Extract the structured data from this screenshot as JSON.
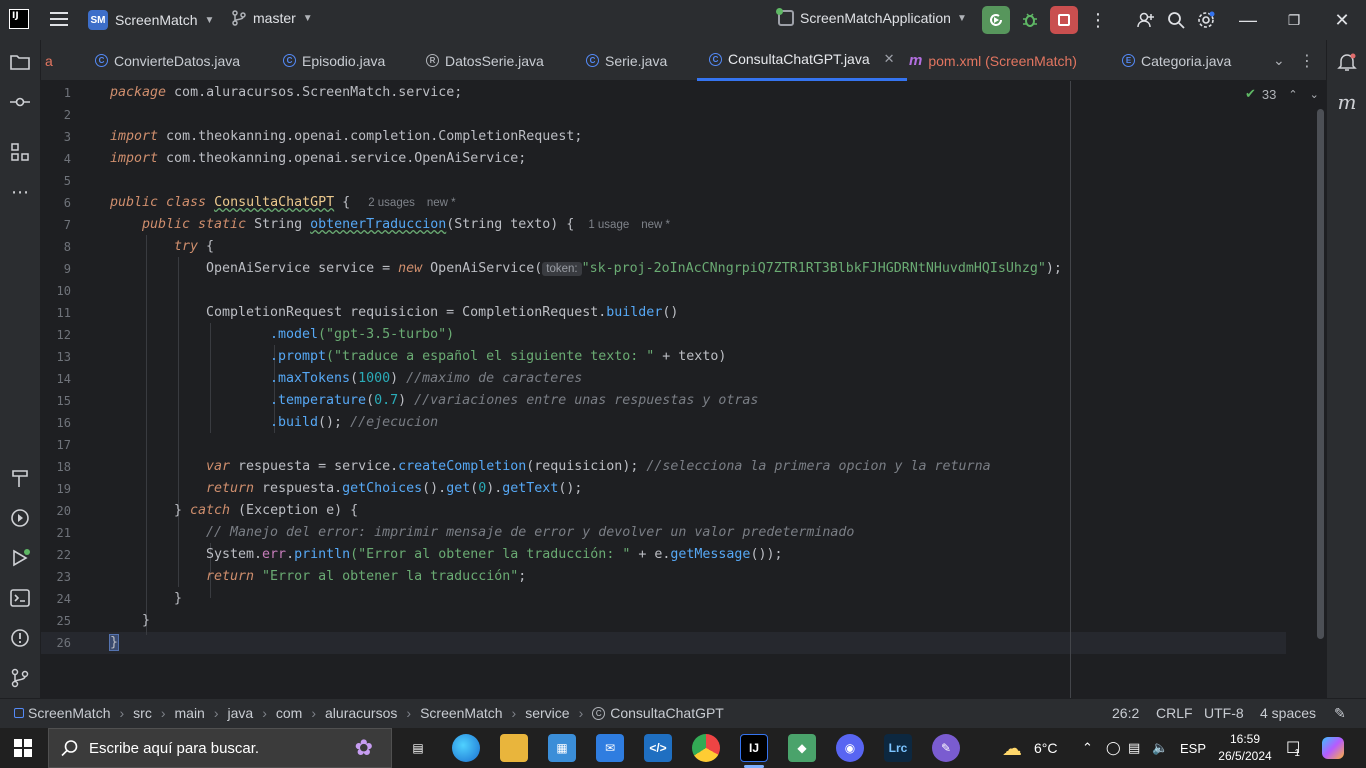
{
  "titlebar": {
    "project": "ScreenMatch",
    "project_badge": "SM",
    "logo": "IJ",
    "branch": "master",
    "run_config": "ScreenMatchApplication"
  },
  "tabs": [
    {
      "label": "a"
    },
    {
      "label": "ConvierteDatos.java"
    },
    {
      "label": "Episodio.java"
    },
    {
      "label": "DatosSerie.java"
    },
    {
      "label": "Serie.java"
    },
    {
      "label": "ConsultaChatGPT.java",
      "active": true
    },
    {
      "label": "pom.xml (ScreenMatch)"
    },
    {
      "label": "Categoria.java"
    }
  ],
  "editor": {
    "line_numbers": [
      "1",
      "2",
      "3",
      "4",
      "5",
      "6",
      "7",
      "8",
      "9",
      "10",
      "11",
      "12",
      "13",
      "14",
      "15",
      "16",
      "17",
      "18",
      "19",
      "20",
      "21",
      "22",
      "23",
      "24",
      "25",
      "26"
    ],
    "inspection_count": "33",
    "hints": {
      "class_usages": "2 usages",
      "class_new": "new *",
      "method_usages": "1 usage",
      "method_new": "new *",
      "token_label": "token:"
    },
    "code": {
      "l1_kw": "package",
      "l1_rest": " com.aluracursos.ScreenMatch.service;",
      "l3_kw": "import",
      "l3_rest": " com.theokanning.openai.completion.CompletionRequest;",
      "l4_kw": "import",
      "l4_rest": " com.theokanning.openai.service.OpenAiService;",
      "l6_kw": "public class ",
      "l6_name": "ConsultaChatGPT",
      "l6_brace": " {",
      "l7_kw": "public static ",
      "l7_type": "String ",
      "l7_fn": "obtenerTraduccion",
      "l7_rest": "(String texto) {",
      "l8_kw": "try",
      "l8_rest": " {",
      "l9_a": "OpenAiService service = ",
      "l9_new": "new",
      "l9_b": " OpenAiService(",
      "l9_str": "\"sk-proj-2oInAcCNngrpiQ7ZTR1RT3BlbkFJHGDRNtNHuvdmHQIsUhzg\"",
      "l9_end": ");",
      "l11_a": "CompletionRequest requisicion = CompletionRequest.",
      "l11_fn": "builder",
      "l11_end": "()",
      "l12_fn": ".model",
      "l12_str": "(\"gpt-3.5-turbo\")",
      "l13_fn": ".prompt",
      "l13_str": "(\"traduce a español el siguiente texto: \"",
      "l13_end": " + texto)",
      "l14_fn": ".maxTokens",
      "l14_num": "1000",
      "l14_cmt": "//maximo de caracteres",
      "l15_fn": ".temperature",
      "l15_num": "0.7",
      "l15_cmt": "//variaciones entre unas respuestas y otras",
      "l16_fn": ".build",
      "l16_cmt": "//ejecucion",
      "l18_kw": "var",
      "l18_a": " respuesta = service.",
      "l18_fn": "createCompletion",
      "l18_b": "(requisicion); ",
      "l18_cmt": "//selecciona la primera opcion y la returna",
      "l19_kw": "return",
      "l19_a": " respuesta.",
      "l19_fn1": "getChoices",
      "l19_b": "().",
      "l19_fn2": "get",
      "l19_num": "0",
      "l19_c": ").",
      "l19_fn3": "getText",
      "l19_end": "();",
      "l20_a": "} ",
      "l20_kw": "catch",
      "l20_b": " (Exception e) {",
      "l21_cmt": "// Manejo del error: imprimir mensaje de error y devolver un valor predeterminado",
      "l22_a": "System.",
      "l22_fld": "err",
      "l22_b": ".",
      "l22_fn": "println",
      "l22_str": "(\"Error al obtener la traducción: \"",
      "l22_c": " + e.",
      "l22_fn2": "getMessage",
      "l22_end": "());",
      "l23_kw": "return",
      "l23_str": " \"Error al obtener la traducción\"",
      "l23_end": ";",
      "l24": "}",
      "l25": "}",
      "l26": "}"
    }
  },
  "statusbar": {
    "breadcrumb": [
      "ScreenMatch",
      "src",
      "main",
      "java",
      "com",
      "aluracursos",
      "ScreenMatch",
      "service",
      "ConsultaChatGPT"
    ],
    "position": "26:2",
    "line_sep": "CRLF",
    "encoding": "UTF-8",
    "indent": "4 spaces"
  },
  "taskbar": {
    "search_placeholder": "Escribe aquí para buscar.",
    "temperature": "6°C",
    "lang": "ESP",
    "time": "16:59",
    "date": "26/5/2024",
    "notif_count": "1",
    "apps": [
      "task-view",
      "edge",
      "file-explorer",
      "store",
      "mail",
      "vscode",
      "chrome",
      "intellij",
      "git",
      "discord",
      "lightroom",
      "paint"
    ]
  },
  "colors": {
    "accent": "#3574f0",
    "run": "#57965c",
    "stop": "#c94f4f",
    "keyword": "#cf8e6d",
    "string": "#6aab73",
    "number": "#2aacb8",
    "function": "#56a8f5"
  }
}
